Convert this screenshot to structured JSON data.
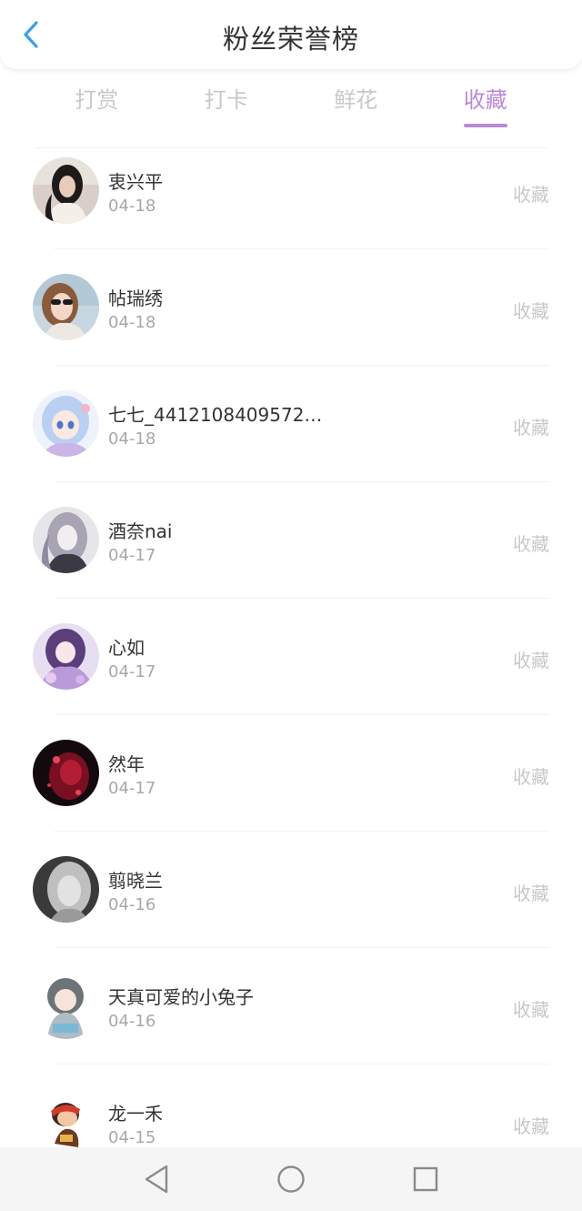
{
  "header": {
    "title": "粉丝荣誉榜",
    "back_icon": "chevron-left-icon",
    "accent_color": "#3aa0e8"
  },
  "tabs": [
    {
      "label": "打赏",
      "active": false
    },
    {
      "label": "打卡",
      "active": false
    },
    {
      "label": "鲜花",
      "active": false
    },
    {
      "label": "收藏",
      "active": true
    }
  ],
  "active_tab_color": "#b98ad8",
  "fans": [
    {
      "name": "衷兴平",
      "date": "04-18",
      "action": "收藏",
      "avatar": "photo-woman-long-dark-hair"
    },
    {
      "name": "帖瑞绣",
      "date": "04-18",
      "action": "收藏",
      "avatar": "photo-woman-sunglasses"
    },
    {
      "name": "七七_44121084095728...",
      "date": "04-18",
      "action": "收藏",
      "avatar": "anime-girl-blue-hair"
    },
    {
      "name": "酒奈nai",
      "date": "04-17",
      "action": "收藏",
      "avatar": "anime-girl-grey"
    },
    {
      "name": "心如",
      "date": "04-17",
      "action": "收藏",
      "avatar": "anime-girl-purple"
    },
    {
      "name": "然年",
      "date": "04-17",
      "action": "收藏",
      "avatar": "dark-red-art"
    },
    {
      "name": "翦晓兰",
      "date": "04-16",
      "action": "收藏",
      "avatar": "photo-woman-grayscale"
    },
    {
      "name": "天真可爱的小兔子",
      "date": "04-16",
      "action": "收藏",
      "avatar": "chibi-character"
    },
    {
      "name": "龙一禾",
      "date": "04-15",
      "action": "收藏",
      "avatar": "cartoon-monkey"
    }
  ],
  "navbar": {
    "back": "triangle-back-icon",
    "home": "circle-home-icon",
    "recents": "square-recents-icon"
  }
}
